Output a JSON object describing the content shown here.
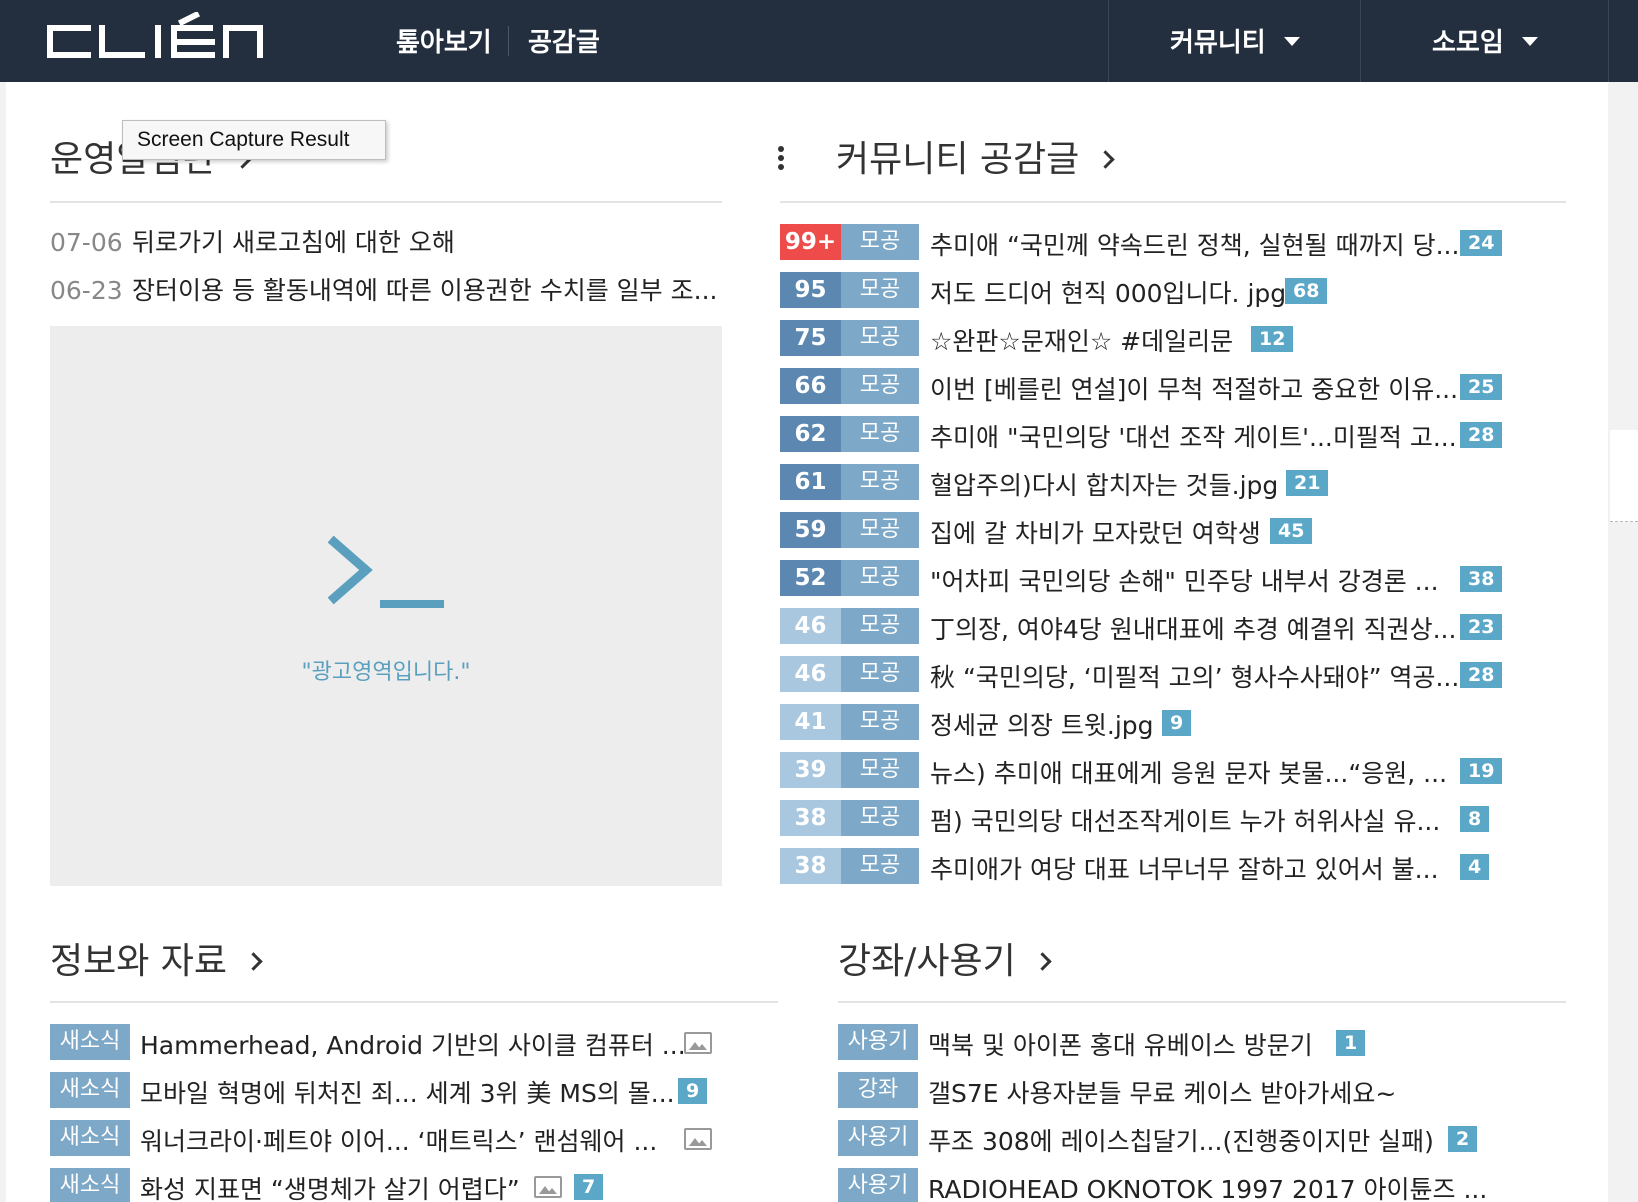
{
  "header": {
    "logo_text": "CLIÉN",
    "nav": [
      "톺아보기",
      "공감글"
    ],
    "menus": [
      "커뮤니티",
      "소모임"
    ]
  },
  "tooltip": "Screen Capture Result",
  "notice_section": {
    "title": "운영알림판",
    "items": [
      {
        "date": "07-06",
        "title": "뒤로가기 새로고침에 대한 오해"
      },
      {
        "date": "06-23",
        "title": "장터이용 등 활동내역에 따른 이용권한 수치를 일부 조..."
      }
    ]
  },
  "ad": {
    "text": "\"광고영역입니다.\""
  },
  "community_section": {
    "title": "커뮤니티 공감글",
    "items": [
      {
        "count": "99+",
        "category": "모공",
        "title": "추미애 “국민께 약속드린 정책, 실현될 때까지 당...",
        "comments": "24"
      },
      {
        "count": "95",
        "category": "모공",
        "title": "저도 드디어 현직 000입니다. jpg",
        "comments": "68"
      },
      {
        "count": "75",
        "category": "모공",
        "title": "☆완판☆문재인☆ #데일리문",
        "comments": "12"
      },
      {
        "count": "66",
        "category": "모공",
        "title": "이번 [베를린 연설]이 무척 적절하고 중요한 이유...",
        "comments": "25"
      },
      {
        "count": "62",
        "category": "모공",
        "title": "추미애 \"국민의당 '대선 조작 게이트'...미필적 고...",
        "comments": "28"
      },
      {
        "count": "61",
        "category": "모공",
        "title": "혈압주의)다시 합치자는 것들.jpg",
        "comments": "21"
      },
      {
        "count": "59",
        "category": "모공",
        "title": "집에 갈 차비가 모자랐던 여학생",
        "comments": "45"
      },
      {
        "count": "52",
        "category": "모공",
        "title": "\"어차피 국민의당 손해\" 민주당 내부서 강경론 ...",
        "comments": "38"
      },
      {
        "count": "46",
        "category": "모공",
        "title": "丁의장, 여야4당 원내대표에 추경 예결위 직권상...",
        "comments": "23"
      },
      {
        "count": "46",
        "category": "모공",
        "title": "秋 “국민의당, ‘미필적 고의’ 형사수사돼야” 역공....",
        "comments": "28"
      },
      {
        "count": "41",
        "category": "모공",
        "title": "정세균 의장 트윗.jpg",
        "comments": "9"
      },
      {
        "count": "39",
        "category": "모공",
        "title": "뉴스) 추미애 대표에게 응원 문자 봇물...“응원, ...",
        "comments": "19"
      },
      {
        "count": "38",
        "category": "모공",
        "title": "펌) 국민의당 대선조작게이트 누가 허위사실 유...",
        "comments": "8"
      },
      {
        "count": "38",
        "category": "모공",
        "title": "추미애가 여당 대표 너무너무 잘하고 있어서 불...",
        "comments": "4"
      }
    ]
  },
  "info_section": {
    "title": "정보와 자료",
    "items": [
      {
        "tag": "새소식",
        "title": "Hammerhead, Android 기반의 사이클 컴퓨터 ...",
        "comments": "",
        "has_image": true
      },
      {
        "tag": "새소식",
        "title": "모바일 혁명에 뒤처진 죄... 세계 3위 美 MS의 몰...",
        "comments": "9",
        "has_image": false
      },
      {
        "tag": "새소식",
        "title": "워너크라이·페트야 이어... ‘매트릭스’ 랜섬웨어 ...",
        "comments": "",
        "has_image": true
      },
      {
        "tag": "새소식",
        "title": "화성 지표면 “생명체가 살기 어렵다”",
        "comments": "7",
        "has_image": true
      }
    ]
  },
  "review_section": {
    "title": "강좌/사용기",
    "items": [
      {
        "tag": "사용기",
        "title": "맥북 및 아이폰 홍대 유베이스 방문기",
        "comments": "1"
      },
      {
        "tag": "강좌",
        "title": "갤S7E 사용자분들 무료 케이스 받아가세요~",
        "comments": ""
      },
      {
        "tag": "사용기",
        "title": "푸조 308에 레이스칩달기...(진행중이지만 실패)",
        "comments": "2"
      },
      {
        "tag": "사용기",
        "title": "RADIOHEAD OKNOTOK 1997 2017 아이튠즈 ...",
        "comments": ""
      }
    ]
  },
  "colors": {
    "header_bg": "#232f3e",
    "hot": "#ee4b4b",
    "count_dark": "#5c87b0",
    "count_mid": "#7da8c7",
    "count_light": "#a9c8e0",
    "category": "#7da8c7",
    "badge": "#5aa7c8",
    "ad_accent": "#5aa0be"
  }
}
